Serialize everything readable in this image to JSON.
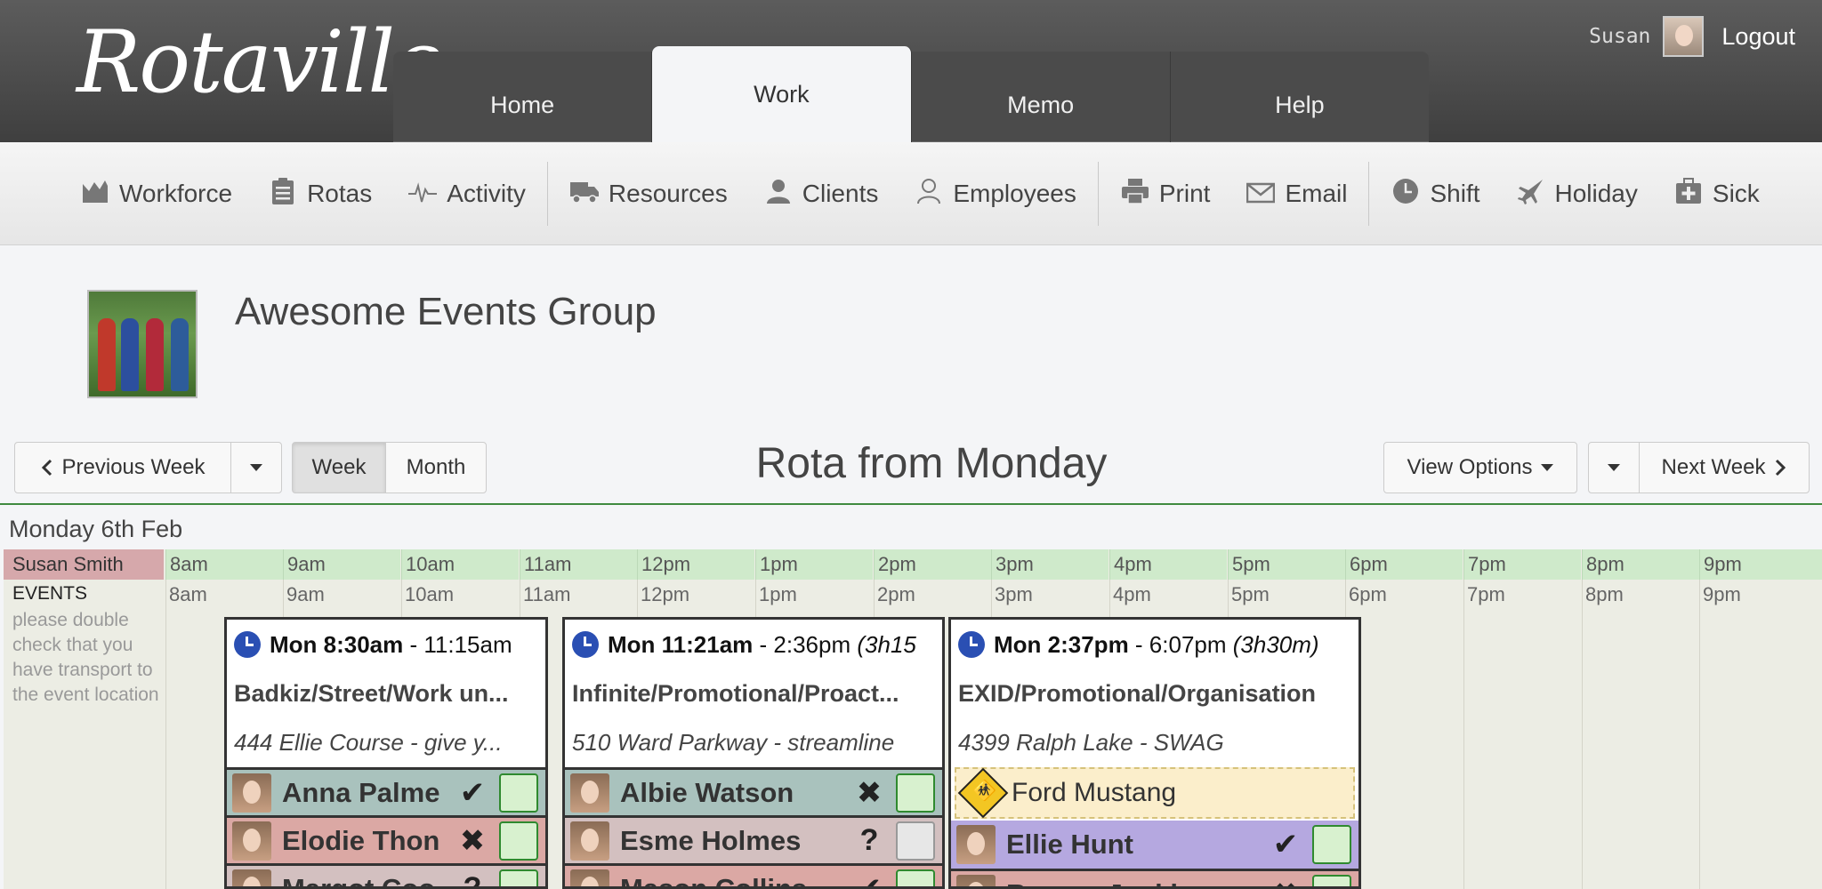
{
  "app": {
    "logo": "Rotaville"
  },
  "nav_tabs": [
    {
      "label": "Home"
    },
    {
      "label": "Work"
    },
    {
      "label": "Memo"
    },
    {
      "label": "Help"
    }
  ],
  "user": {
    "name": "Susan",
    "logout": "Logout"
  },
  "toolbar": [
    {
      "label": "Workforce",
      "icon": "chart-icon"
    },
    {
      "label": "Rotas",
      "icon": "clipboard-icon"
    },
    {
      "label": "Activity",
      "icon": "pulse-icon"
    },
    {
      "label": "Resources",
      "icon": "truck-icon"
    },
    {
      "label": "Clients",
      "icon": "client-icon"
    },
    {
      "label": "Employees",
      "icon": "user-icon"
    },
    {
      "label": "Print",
      "icon": "printer-icon"
    },
    {
      "label": "Email",
      "icon": "envelope-icon"
    },
    {
      "label": "Shift",
      "icon": "clock-icon"
    },
    {
      "label": "Holiday",
      "icon": "plane-icon"
    },
    {
      "label": "Sick",
      "icon": "medkit-icon"
    }
  ],
  "company": {
    "name": "Awesome Events Group"
  },
  "controls": {
    "prev_week": "Previous Week",
    "week": "Week",
    "month": "Month",
    "title": "Rota from Monday",
    "view_options": "View Options",
    "next_week": "Next Week"
  },
  "day": {
    "label": "Monday 6th Feb",
    "employee": "Susan Smith",
    "hours": [
      "8am",
      "9am",
      "10am",
      "11am",
      "12pm",
      "1pm",
      "2pm",
      "3pm",
      "4pm",
      "5pm",
      "6pm",
      "7pm",
      "8pm",
      "9pm"
    ],
    "events_title": "EVENTS",
    "events_note": "please double check that you have transport to the event location"
  },
  "shifts": [
    {
      "start": "Mon 8:30am",
      "end": "11:15am",
      "duration": "",
      "title": "Badkiz/Street/Work un...",
      "location": "444 Ellie Course - give y...",
      "staff": [
        {
          "name": "Anna Palme",
          "status": "✔",
          "confirm": "green",
          "color": "teal"
        },
        {
          "name": "Elodie Thon",
          "status": "✖",
          "confirm": "green",
          "color": "rose"
        },
        {
          "name": "Margot Coo",
          "status": "?",
          "confirm": "green",
          "color": "mauve"
        }
      ]
    },
    {
      "start": "Mon 11:21am",
      "end": "2:36pm",
      "duration": "(3h15",
      "title": "Infinite/Promotional/Proact...",
      "location": "510 Ward Parkway - streamline",
      "staff": [
        {
          "name": "Albie Watson",
          "status": "✖",
          "confirm": "green",
          "color": "teal"
        },
        {
          "name": "Esme Holmes",
          "status": "?",
          "confirm": "grey",
          "color": "mauve"
        },
        {
          "name": "Mason Collins",
          "status": "✔",
          "confirm": "green",
          "color": "rose"
        }
      ]
    },
    {
      "start": "Mon 2:37pm",
      "end": "6:07pm",
      "duration": "(3h30m)",
      "title": "EXID/Promotional/Organisation",
      "location": "4399 Ralph Lake - SWAG",
      "resource": "Ford Mustang",
      "staff": [
        {
          "name": "Ellie Hunt",
          "status": "✔",
          "confirm": "green",
          "color": "purple"
        },
        {
          "name": "Ramon Jenkins",
          "status": "✖",
          "confirm": "green",
          "color": "rose"
        }
      ]
    }
  ]
}
